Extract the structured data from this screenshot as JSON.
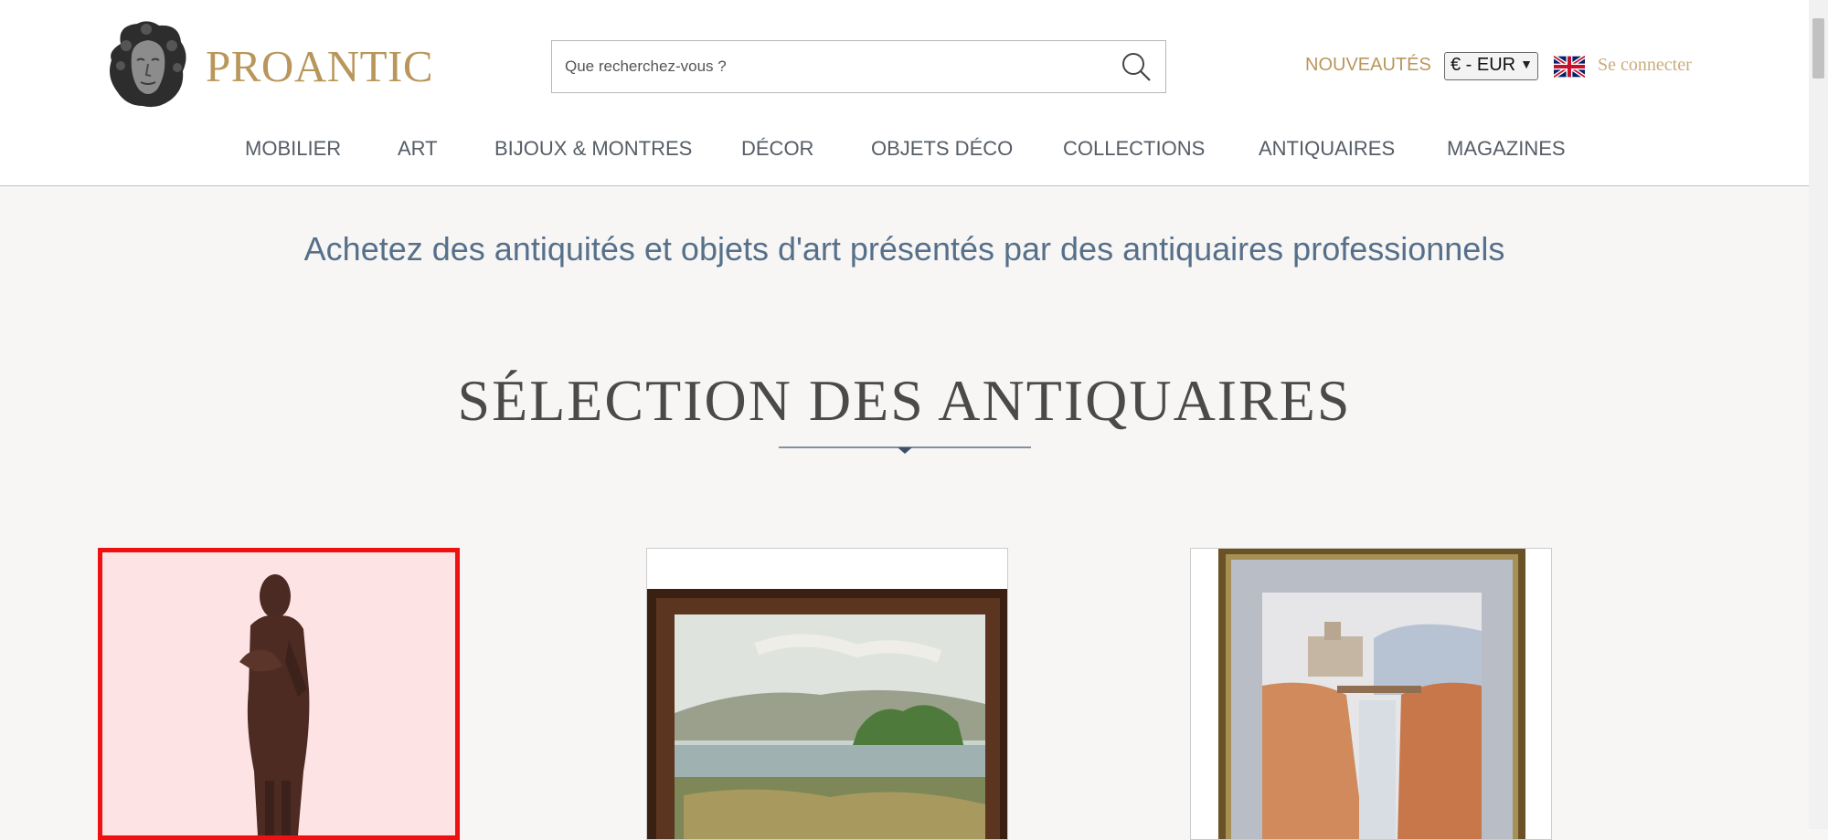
{
  "header": {
    "logo_text": "PROANTIC",
    "logo_icon": "sculpted-head-logo-icon",
    "search": {
      "placeholder": "Que recherchez-vous ?",
      "icon": "search-icon"
    },
    "nouveautes_label": "NOUVEAUTÉS",
    "currency": {
      "selected": "€ - EUR",
      "icon": "chevron-down-icon"
    },
    "language_flag": "uk-flag-icon",
    "login_label": "Se connecter"
  },
  "nav": {
    "items": [
      {
        "label": "MOBILIER"
      },
      {
        "label": "ART"
      },
      {
        "label": "BIJOUX & MONTRES"
      },
      {
        "label": "DÉCOR"
      },
      {
        "label": "OBJETS DÉCO"
      },
      {
        "label": "COLLECTIONS"
      },
      {
        "label": "ANTIQUAIRES"
      },
      {
        "label": "MAGAZINES"
      }
    ]
  },
  "main": {
    "tagline": "Achetez des antiquités et objets d'art présentés par des antiquaires professionnels",
    "section_title": "SÉLECTION DES ANTIQUAIRES",
    "products": [
      {
        "image": "carved-wood-figure-statue",
        "highlighted": true
      },
      {
        "image": "framed-landscape-painting-river",
        "highlighted": false
      },
      {
        "image": "framed-watercolor-gorge-bridge",
        "highlighted": false
      }
    ]
  },
  "colors": {
    "brand_gold": "#b9965a",
    "tagline_blue": "#56708b",
    "highlight_red": "#ee1111"
  }
}
